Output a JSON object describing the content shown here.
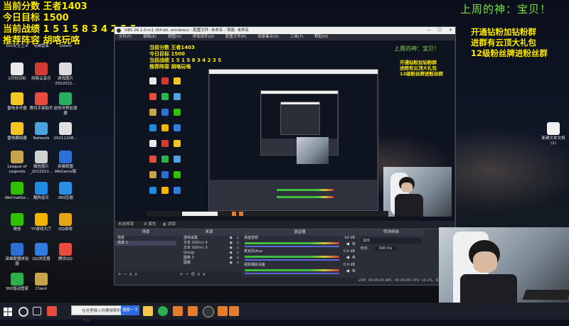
{
  "overlay": {
    "score": "当前分数 王者1403",
    "goal": "今日目标 1500",
    "record": "当前战绩 1 5 1 5 8 3 4 2 3 5",
    "lineup": "推荐阵容 胡咯玩咯",
    "weekly_god": "上周的神：宝贝！",
    "perks": [
      "开通钻粉加钻粉群",
      "进群有云顶大礼包",
      "12级粉丝牌进粉丝群"
    ]
  },
  "desktop_icons": [
    {
      "label": "360安全卫士",
      "color": "#2bb24c"
    },
    {
      "label": "电脑管家",
      "color": "#3a7be0"
    },
    {
      "label": "Steam",
      "color": "#1b2838"
    },
    {
      "label": "1月份目标",
      "color": "#e8e8e8"
    },
    {
      "label": "网易云音乐",
      "color": "#d33a31"
    },
    {
      "label": "游戏图片 2022021...",
      "color": "#dcdcdc"
    },
    {
      "label": "雷电多开器",
      "color": "#f3c623"
    },
    {
      "label": "腾讯手游助手",
      "color": "#e74c3c"
    },
    {
      "label": "迷你世界加速器",
      "color": "#27ae60"
    },
    {
      "label": "雷电模拟器",
      "color": "#f3c623"
    },
    {
      "label": "Network",
      "color": "#4aa3df"
    },
    {
      "label": "20211208...",
      "color": "#e0e0e0"
    },
    {
      "label": "League of Legends",
      "color": "#c9a34a"
    },
    {
      "label": "微信图片 _2022021...",
      "color": "#d0d0d0"
    },
    {
      "label": "英雄联盟 WeGame版",
      "color": "#2c6fd6"
    },
    {
      "label": "WeChatGe...",
      "color": "#2dc100"
    },
    {
      "label": "酷狗音乐",
      "color": "#1f8ae0"
    },
    {
      "label": "360压缩",
      "color": "#2b8fe8"
    },
    {
      "label": "微信",
      "color": "#2dc100"
    },
    {
      "label": "YY游戏大厅",
      "color": "#f4b400"
    },
    {
      "label": "QQ游戏",
      "color": "#e8a317"
    },
    {
      "label": "英雄联盟体验服",
      "color": "#2c6fd6"
    },
    {
      "label": "QQ浏览器",
      "color": "#2f7de1"
    },
    {
      "label": "腾讯QQ",
      "color": "#e74c3c"
    },
    {
      "label": "360驱动管家",
      "color": "#2bb24c"
    },
    {
      "label": "Client",
      "color": "#c9a34a"
    },
    {
      "label": "新建文本文档 (1)",
      "color": "#f0f0f0"
    }
  ],
  "obs": {
    "title": "OBS 26.1.0-rc1 (64-bit, windows) - 配置文件: 未命名 - 场景: 未命名",
    "menu": [
      "文件(F)",
      "编辑(E)",
      "视图(V)",
      "停靠部件(D)",
      "配置文件(P)",
      "场景集合(S)",
      "工具(T)",
      "帮助(H)"
    ],
    "source_bar": [
      "未选择源",
      "属性",
      "滤镜"
    ],
    "scenes_title": "场景",
    "scenes": [
      "场景",
      "场景 2"
    ],
    "sources_title": "来源",
    "sources": [
      "游戏采集",
      "文本 (GDI+) 4",
      "文本 (GDI+) 3",
      "Group",
      "图像 3",
      "图像"
    ],
    "mixer_title": "混音器",
    "mixer": [
      {
        "name": "桌面音频",
        "db": "-inf dB"
      },
      {
        "name": "麦克风/Aux",
        "db": "0.0 dB"
      },
      {
        "name": "视频捕获设备",
        "db": "0.0 dB"
      }
    ],
    "transition_title": "转场特效",
    "transition_value": "淡出",
    "duration_label": "时长",
    "duration_value": "300 ms",
    "status": "LIVE: 00:00:00   REC: 00:00:00   CPU: 10.2%, 30.00 fps"
  },
  "taskbar": {
    "search_placeholder": "在这里输入你要搜索的内容",
    "search_button": "搜索一下"
  },
  "icons": [
    "windows-start-icon",
    "search-icon",
    "task-view-icon",
    "edge-icon",
    "file-explorer-icon",
    "obs-icon",
    "wegame-icon"
  ]
}
